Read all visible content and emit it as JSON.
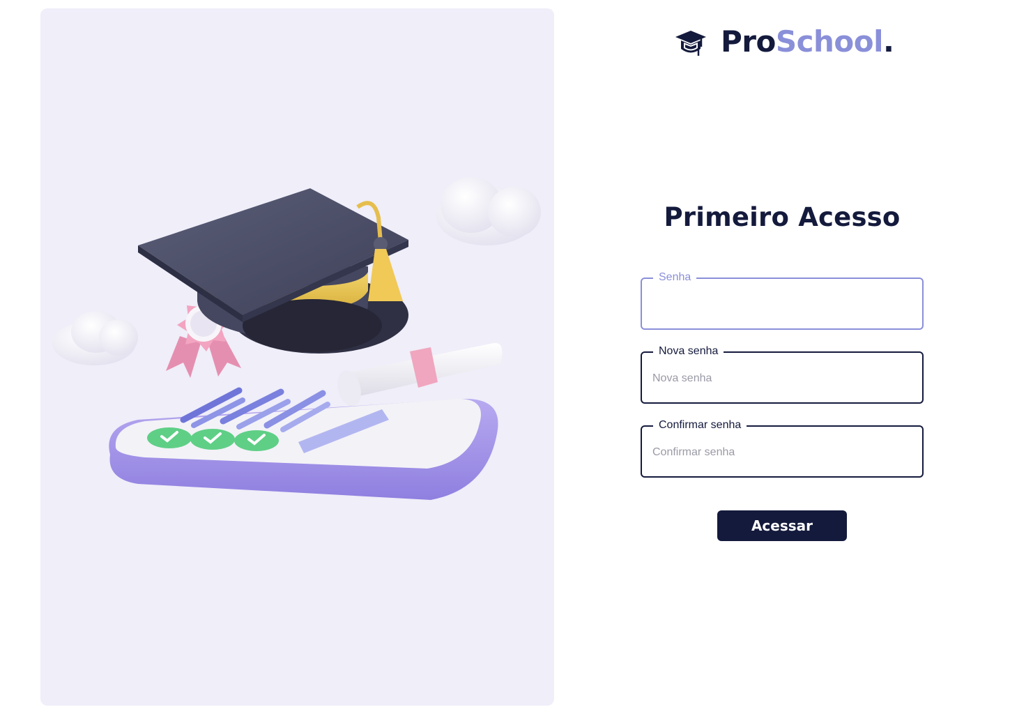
{
  "brand": {
    "name_part1": "Pro",
    "name_part2": "School",
    "name_dot": ".",
    "icon": "graduation-cap-icon",
    "colors": {
      "dark": "#141a3c",
      "accent": "#8a8fd9"
    }
  },
  "form": {
    "title": "Primeiro Acesso",
    "fields": [
      {
        "label": "Senha",
        "placeholder": "",
        "value": "",
        "focused": true
      },
      {
        "label": "Nova senha",
        "placeholder": "Nova senha",
        "value": ""
      },
      {
        "label": "Confirmar senha",
        "placeholder": "Confirmar senha",
        "value": ""
      }
    ],
    "submit_label": "Acessar"
  },
  "illustration": {
    "subject": "graduation-cap-diploma-checklist-illustration",
    "background": "#efeef9"
  }
}
